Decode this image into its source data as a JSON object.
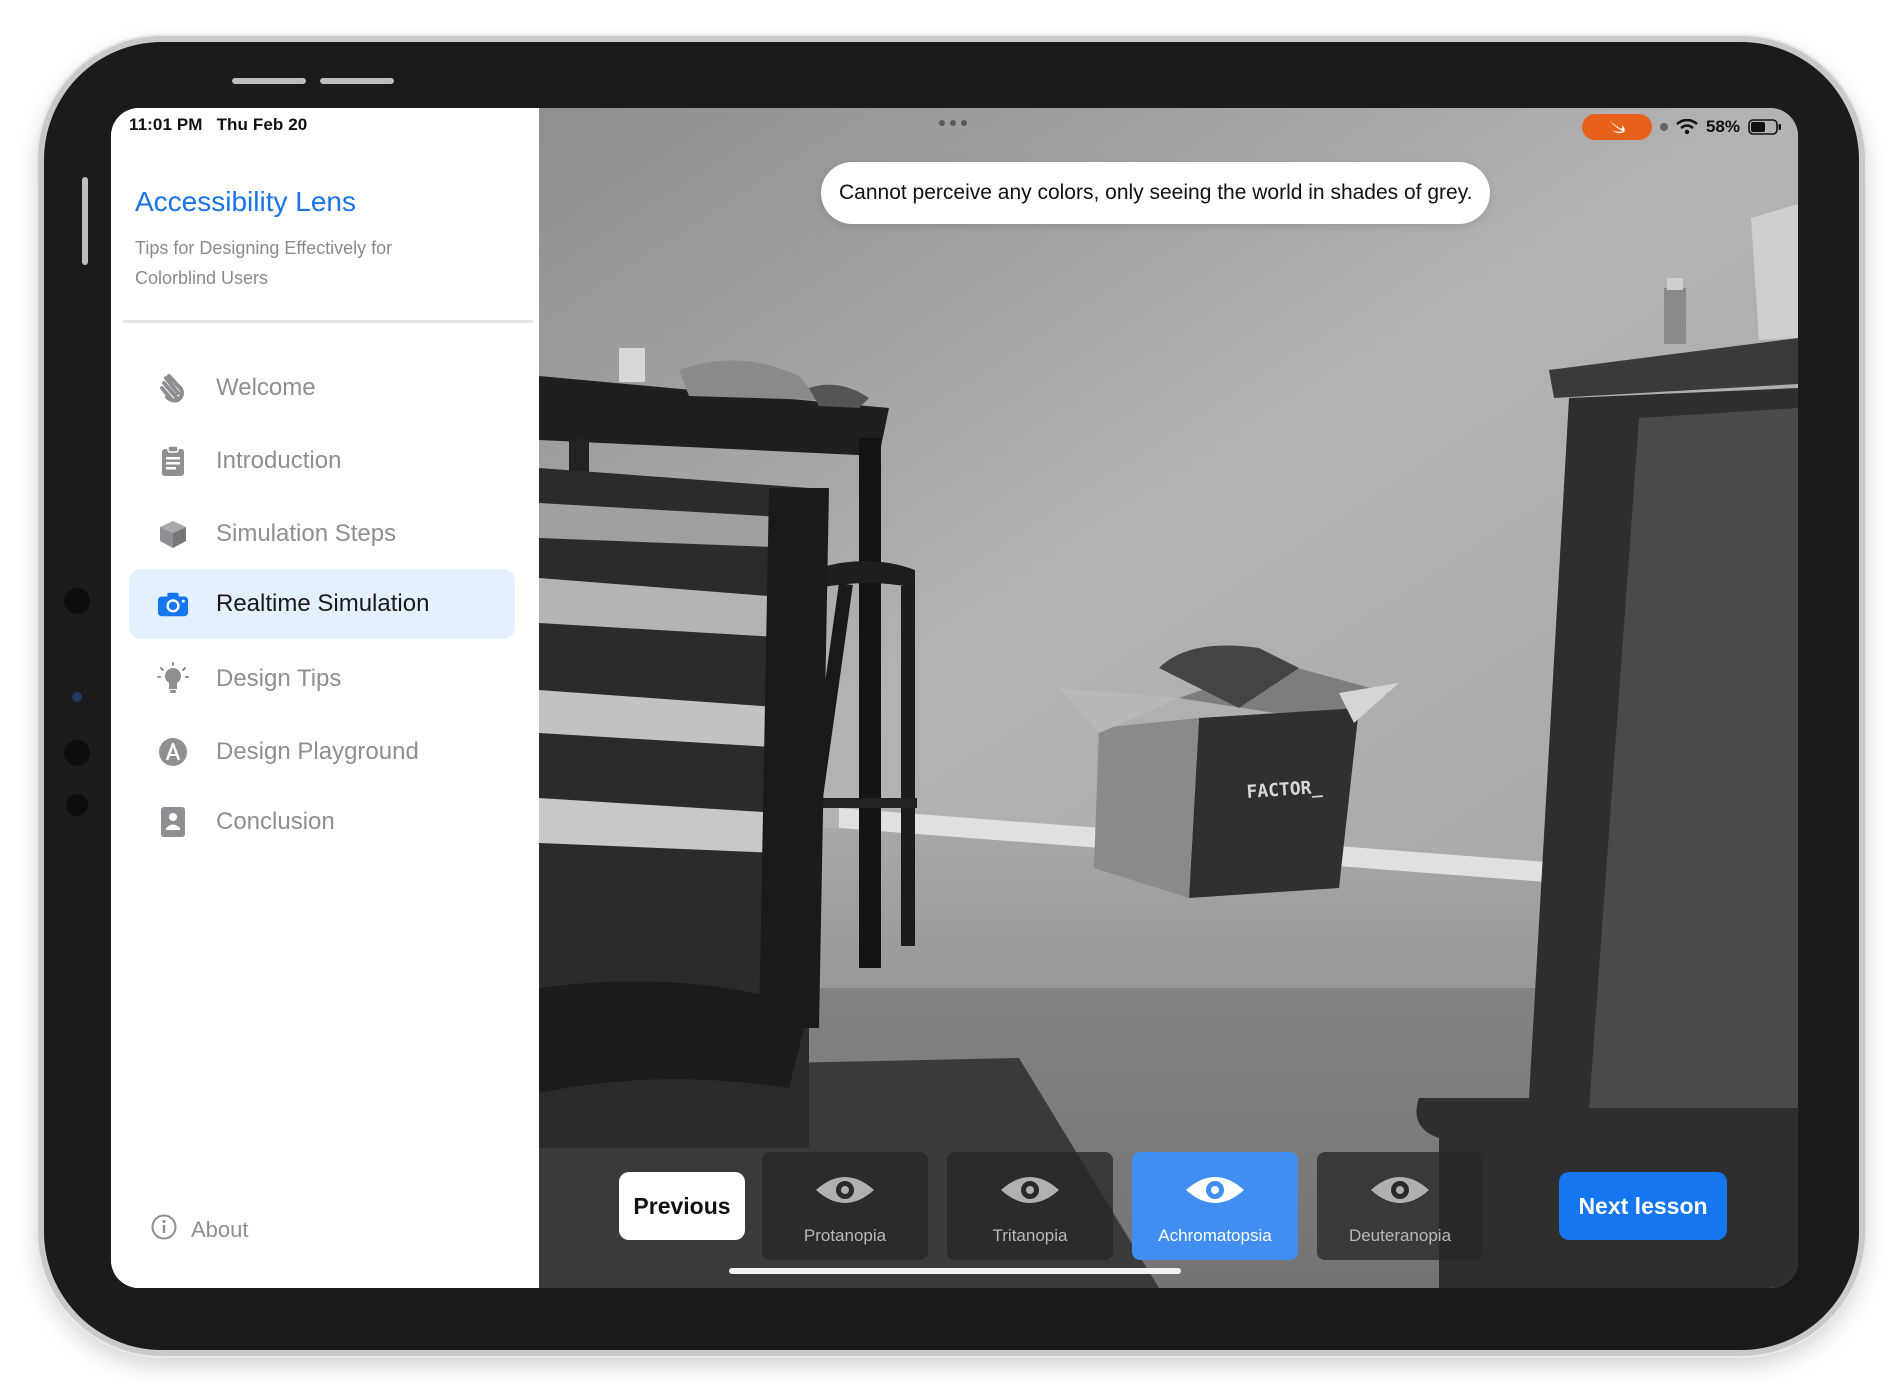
{
  "status_bar": {
    "time": "11:01 PM",
    "date": "Thu Feb 20",
    "battery": "58%"
  },
  "sidebar": {
    "title": "Accessibility Lens",
    "subtitle": "Tips for Designing Effectively for Colorblind Users",
    "items": [
      {
        "label": "Welcome",
        "icon": "hand-wave-icon"
      },
      {
        "label": "Introduction",
        "icon": "clipboard-icon"
      },
      {
        "label": "Simulation Steps",
        "icon": "cube-icon"
      },
      {
        "label": "Realtime Simulation",
        "icon": "camera-icon",
        "active": true
      },
      {
        "label": "Design Tips",
        "icon": "lightbulb-icon"
      },
      {
        "label": "Design Playground",
        "icon": "pencil-circle-icon"
      },
      {
        "label": "Conclusion",
        "icon": "badge-icon"
      }
    ],
    "about_label": "About"
  },
  "camera": {
    "tooltip": "Cannot perceive any colors, only seeing the world in shades of grey.",
    "box_text": "FACTOR_",
    "previous_label": "Previous",
    "next_label": "Next lesson",
    "filters": [
      {
        "label": "Protanopia",
        "active": false
      },
      {
        "label": "Tritanopia",
        "active": false
      },
      {
        "label": "Achromatopsia",
        "active": true
      },
      {
        "label": "Deuteranopia",
        "active": false
      }
    ]
  },
  "colors": {
    "accent": "#1477f0",
    "title_blue": "#1a73e8",
    "active_row": "#e4efff",
    "recording_pill": "#e8611a"
  }
}
